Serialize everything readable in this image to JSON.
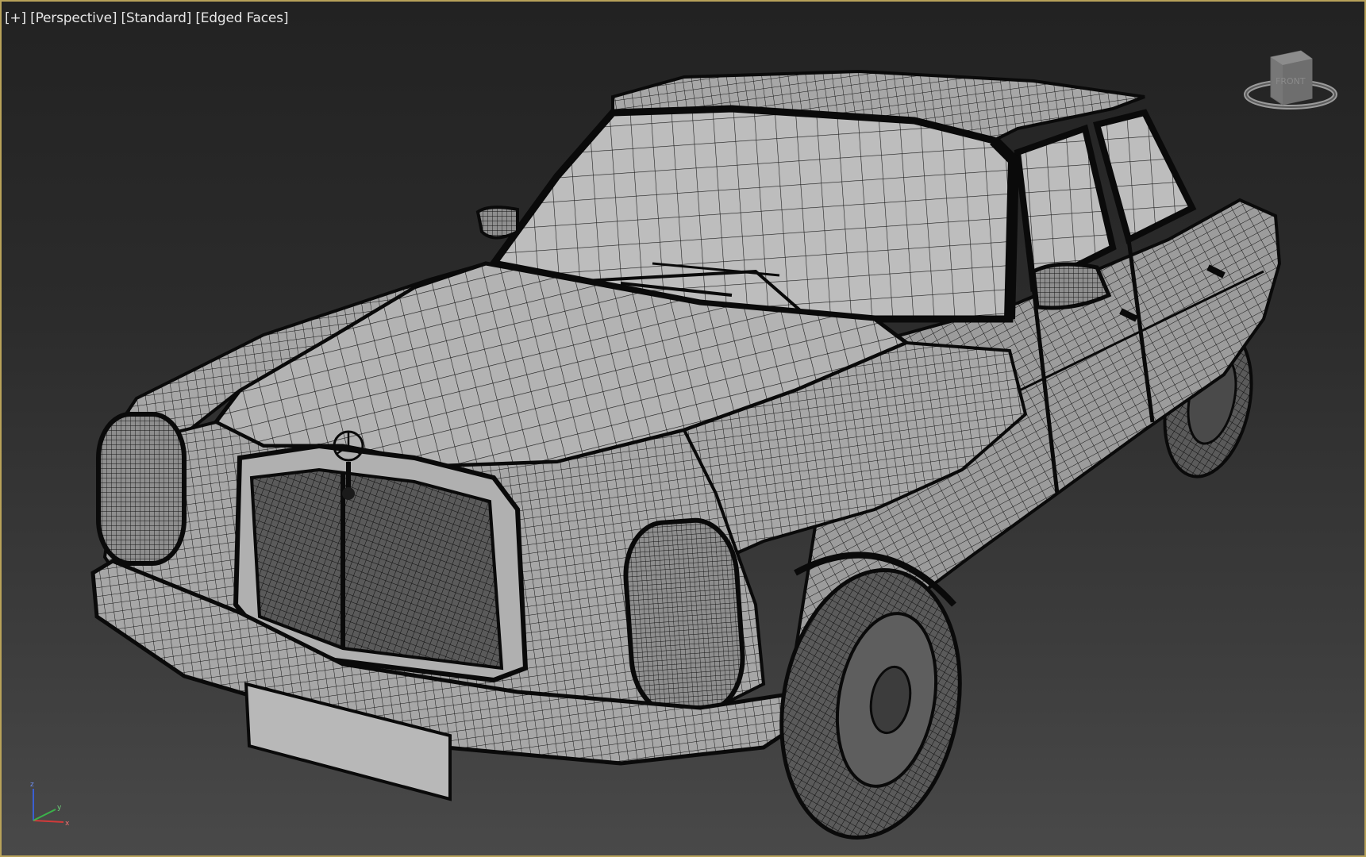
{
  "viewport": {
    "labels": {
      "plus": "[+]",
      "view": "[Perspective]",
      "shading": "[Standard]",
      "edges": "[Edged Faces]"
    },
    "viewcube": {
      "face": "FRONT"
    },
    "axis": {
      "x": "x",
      "y": "y",
      "z": "z"
    }
  },
  "colors": {
    "viewport_border": "#b8a25a",
    "label_text": "#e6e6e6",
    "mesh_fill": "#a9a9a9",
    "mesh_wire": "#111111",
    "axis_x": "#d23a3a",
    "axis_y": "#3ab34a",
    "axis_z": "#3a5fd2"
  }
}
